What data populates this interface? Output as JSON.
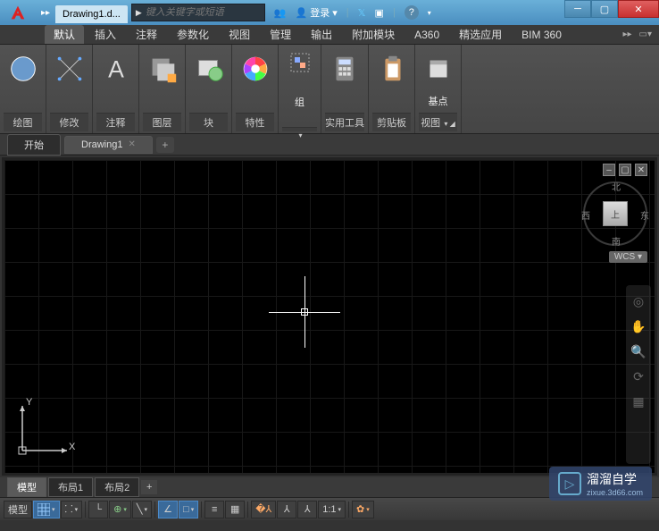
{
  "title_tab": "Drawing1.d...",
  "search_placeholder": "键入关键字或短语",
  "login_label": "登录",
  "ribbon_tabs": [
    "默认",
    "插入",
    "注释",
    "参数化",
    "视图",
    "管理",
    "输出",
    "附加模块",
    "A360",
    "精选应用",
    "BIM 360"
  ],
  "panels": {
    "draw": "绘图",
    "modify": "修改",
    "annot": "注释",
    "layer": "图层",
    "block": "块",
    "prop": "特性",
    "group": "组",
    "util": "实用工具",
    "clip": "剪贴板",
    "base": "基点",
    "view": "视图"
  },
  "file_tabs": {
    "start": "开始",
    "drawing": "Drawing1"
  },
  "ucs": {
    "x": "X",
    "y": "Y"
  },
  "viewcube": {
    "face": "上",
    "n": "北",
    "s": "南",
    "e": "东",
    "w": "西",
    "wcs": "WCS"
  },
  "layout_tabs": {
    "model": "模型",
    "l1": "布局1",
    "l2": "布局2"
  },
  "status": {
    "model": "模型",
    "scale": "1:1"
  },
  "watermark": {
    "title": "溜溜自学",
    "sub": "zixue.3d66.com"
  }
}
